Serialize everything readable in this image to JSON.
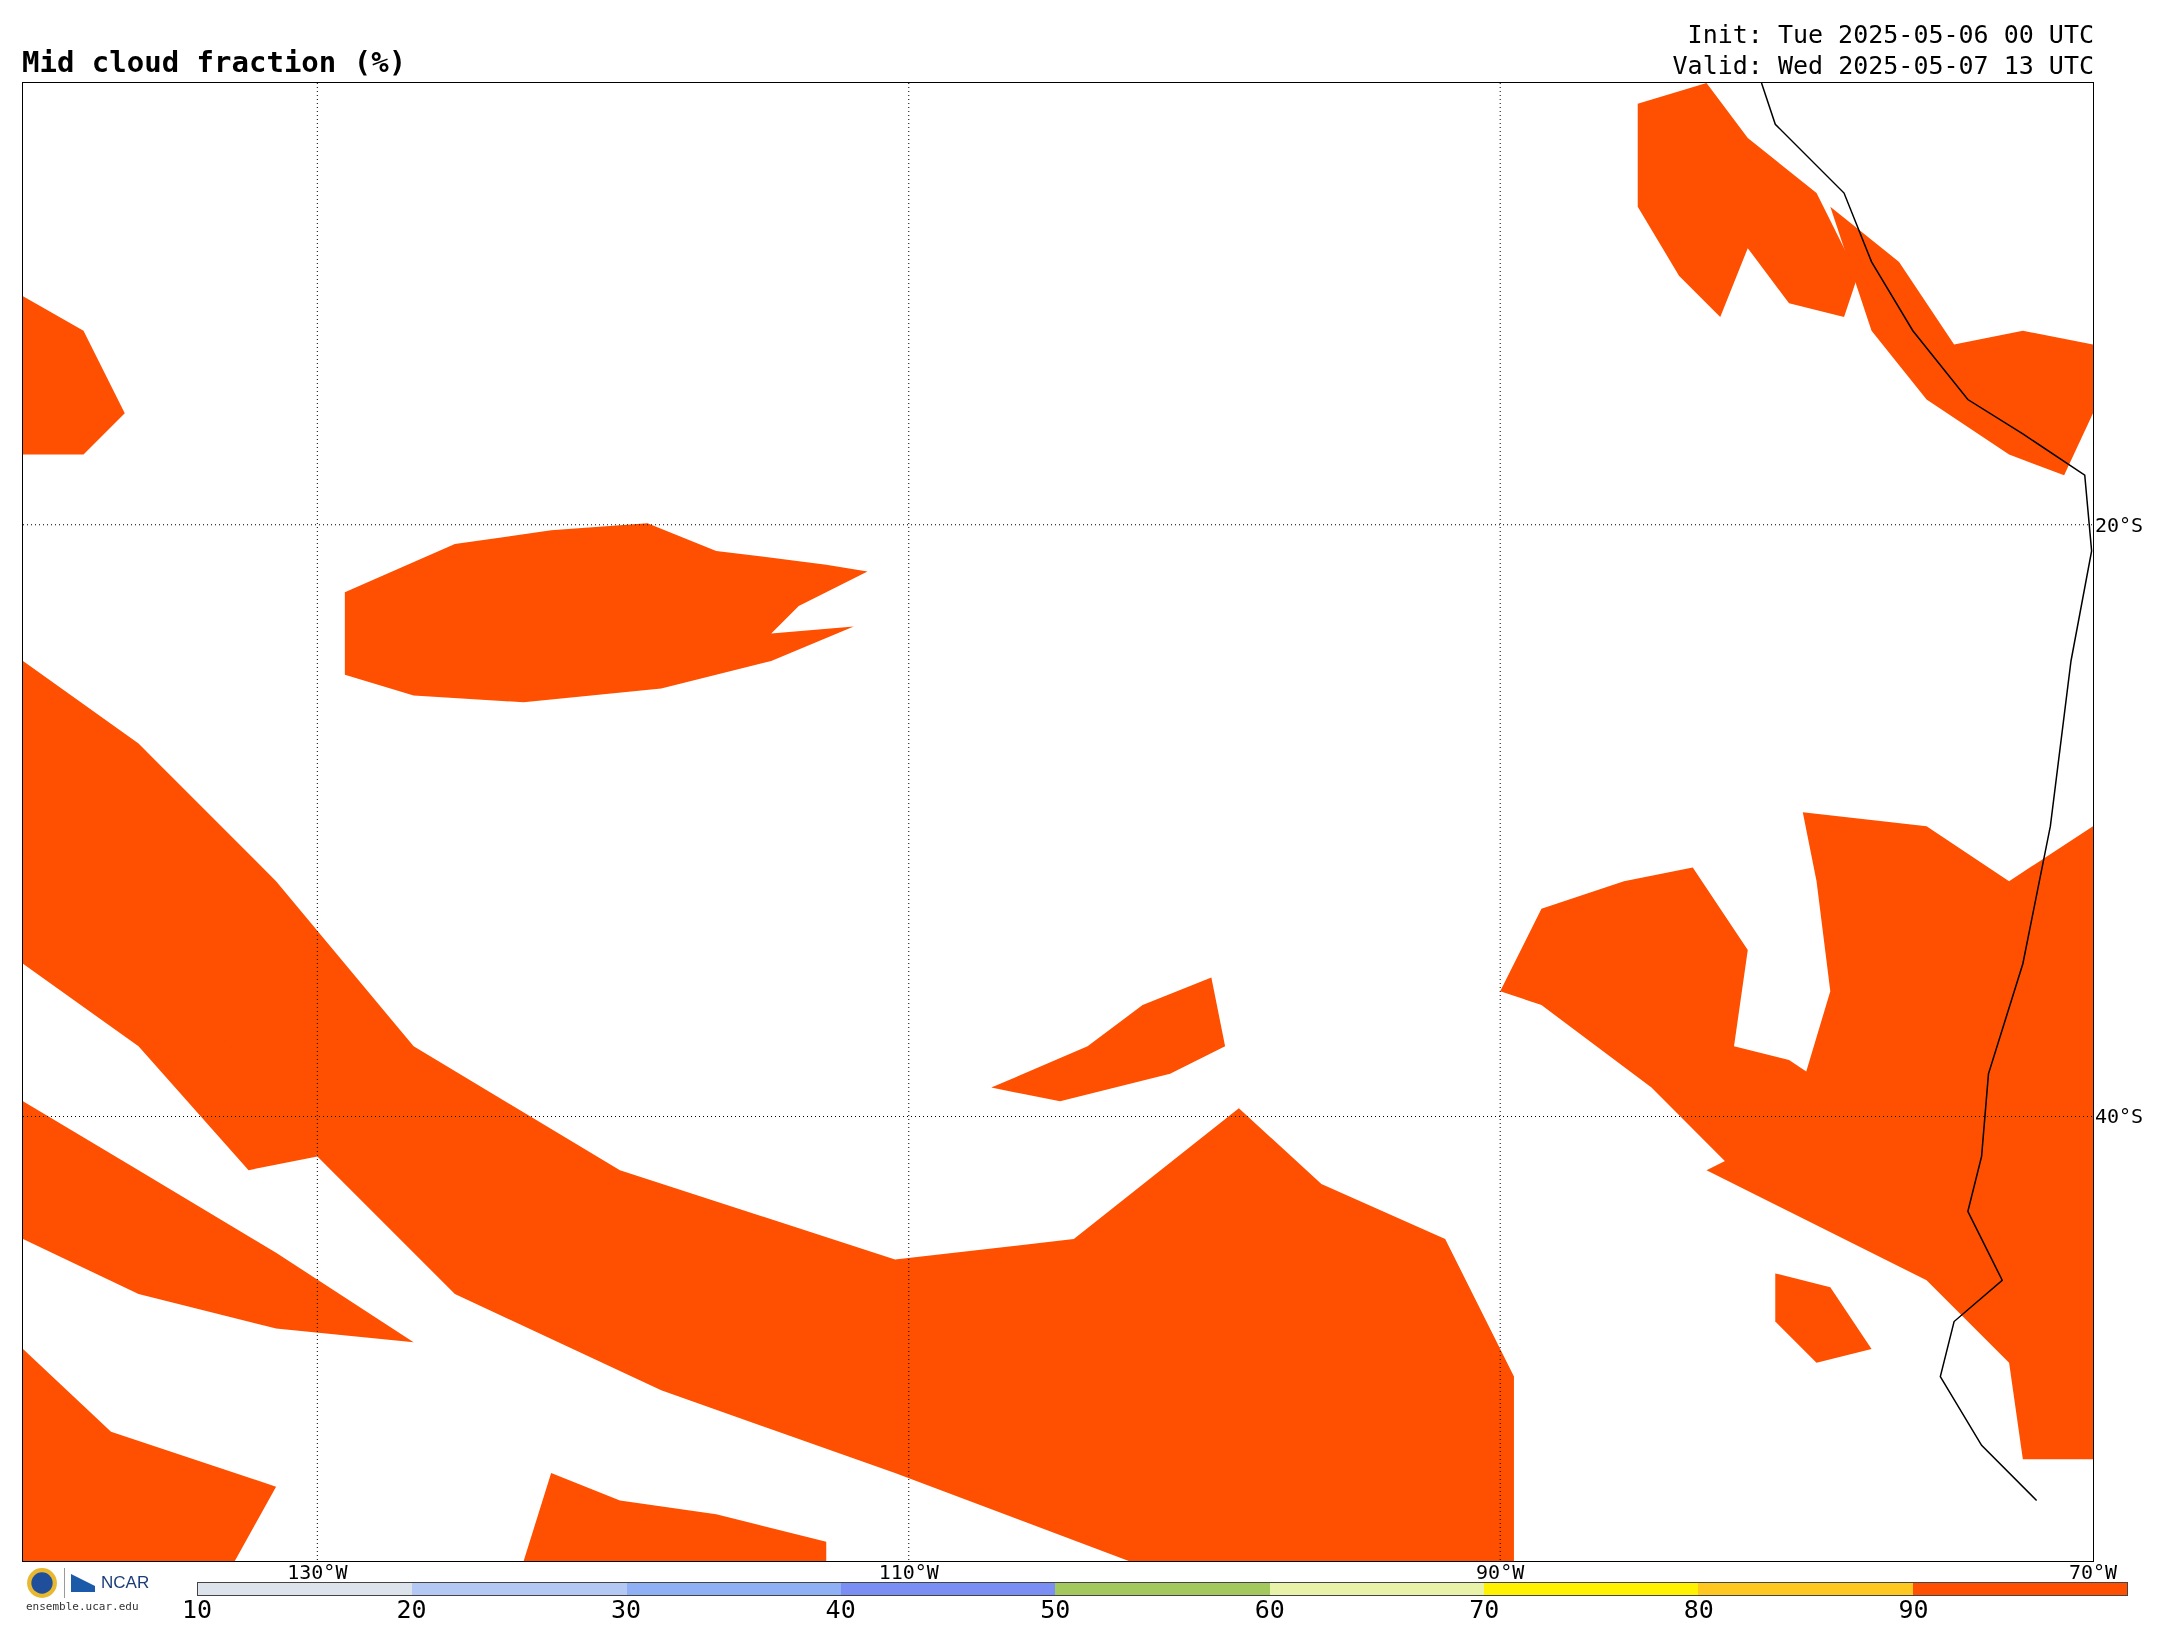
{
  "title": "Mid cloud fraction (%)",
  "init": "Init: Tue 2025-05-06 00 UTC",
  "valid": "Valid: Wed 2025-05-07 13 UTC",
  "map": {
    "longitude_labels": [
      "130°W",
      "110°W",
      "90°W",
      "70°W"
    ],
    "latitude_labels": [
      "20°S",
      "40°S"
    ]
  },
  "colorbar": {
    "segments": [
      {
        "color": "#dde3ea"
      },
      {
        "color": "#b4c8f4"
      },
      {
        "color": "#8fb0f4"
      },
      {
        "color": "#7a8ef4"
      },
      {
        "color": "#a3c85e"
      },
      {
        "color": "#e8f2a8"
      },
      {
        "color": "#fff200"
      },
      {
        "color": "#ffc820"
      },
      {
        "color": "#ff4f00"
      }
    ],
    "tick_labels": [
      "10",
      "20",
      "30",
      "40",
      "50",
      "60",
      "70",
      "80",
      "90"
    ]
  },
  "footer": {
    "logo_text": "NCAR",
    "site": "ensemble.ucar.edu"
  }
}
